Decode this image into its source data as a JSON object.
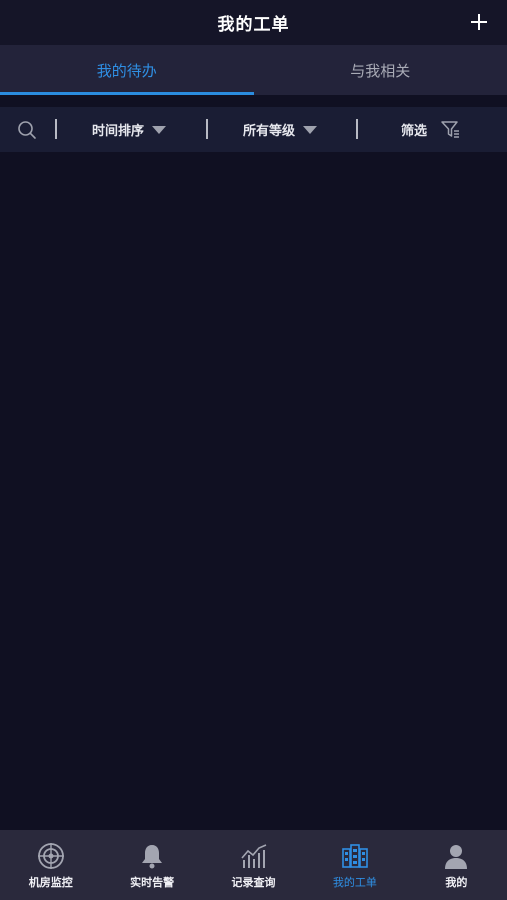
{
  "header": {
    "title": "我的工单"
  },
  "tabs": [
    {
      "label": "我的待办",
      "active": true
    },
    {
      "label": "与我相关",
      "active": false
    }
  ],
  "filters": {
    "sort_label": "时间排序",
    "level_label": "所有等级",
    "filter_label": "筛选"
  },
  "bottom_nav": [
    {
      "label": "机房监控",
      "icon": "target-icon",
      "active": false
    },
    {
      "label": "实时告警",
      "icon": "bell-icon",
      "active": false
    },
    {
      "label": "记录查询",
      "icon": "chart-icon",
      "active": false
    },
    {
      "label": "我的工单",
      "icon": "building-icon",
      "active": true
    },
    {
      "label": "我的",
      "icon": "user-icon",
      "active": false
    }
  ],
  "colors": {
    "background": "#101022",
    "accent": "#2f8fe4",
    "tabbar": "#23233a",
    "filterbar": "#1a1d34",
    "bottomnav": "#2a293c"
  }
}
